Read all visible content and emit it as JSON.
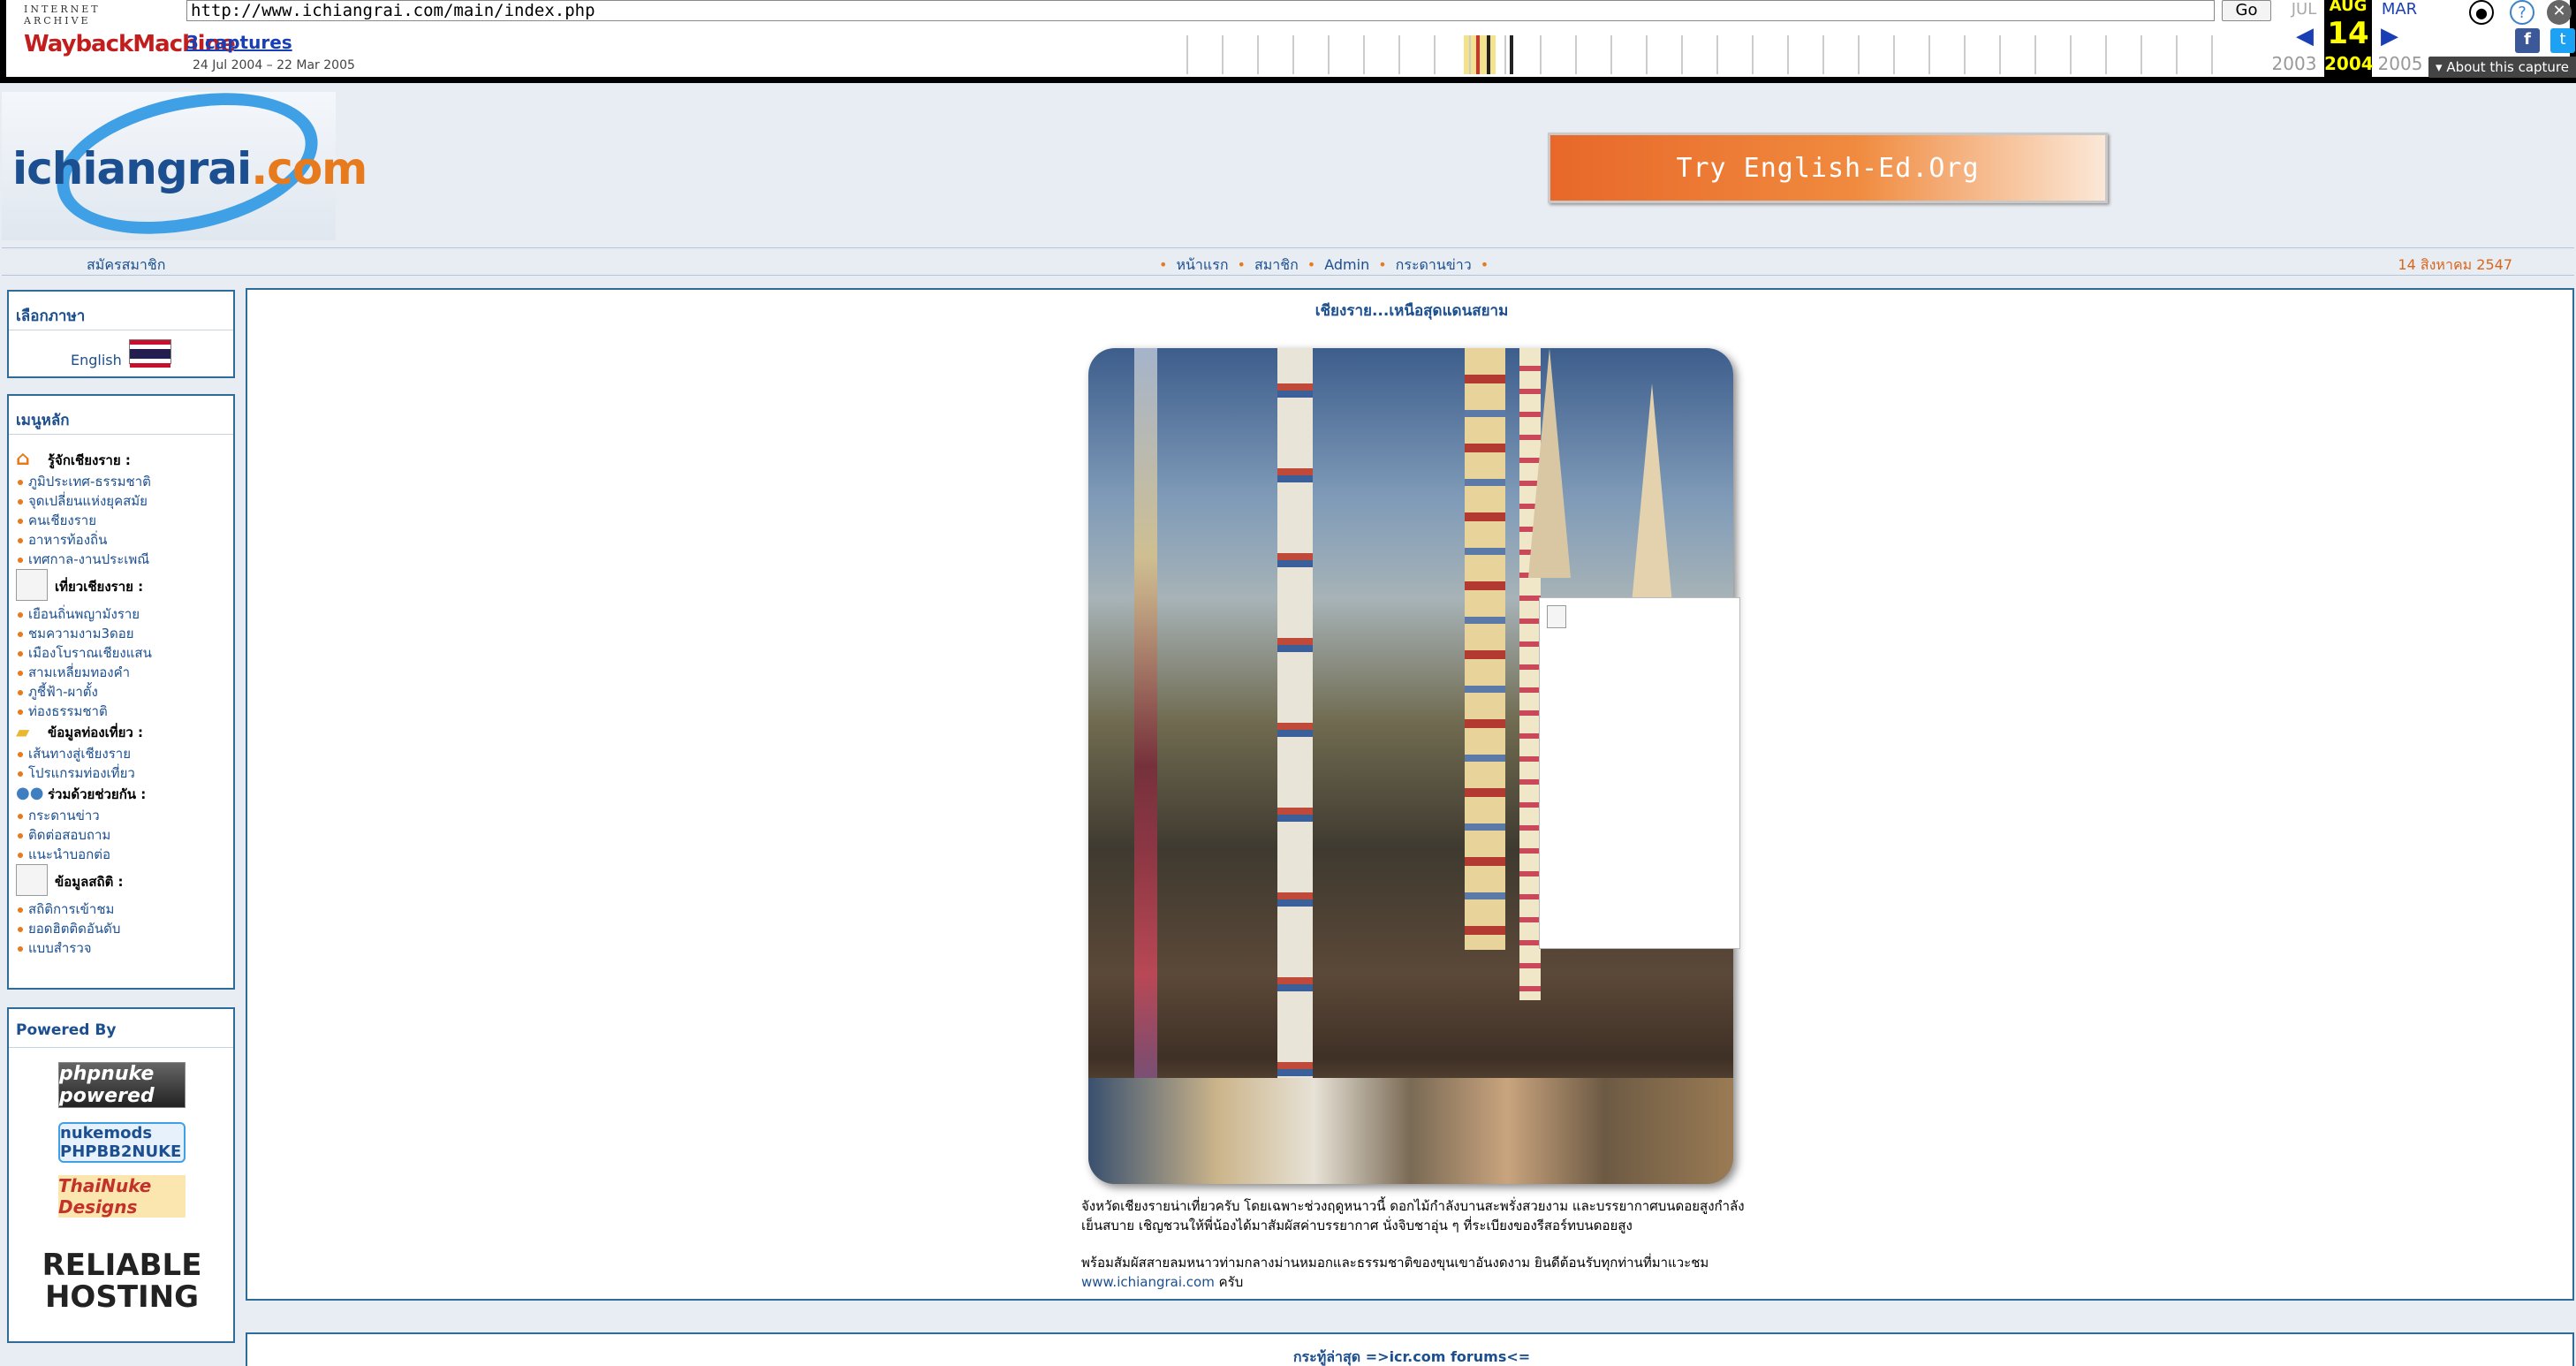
{
  "wayback": {
    "logo_top": "INTERNET ARCHIVE",
    "logo_main": "WaybackMachine",
    "url": "http://www.ichiangrai.com/main/index.php",
    "go_label": "Go",
    "captures": "3 captures",
    "range": "24 Jul 2004 – 22 Mar 2005",
    "month_prev": "JUL",
    "month_cur": "AUG",
    "month_next": "MAR",
    "day": "14",
    "year_prev": "2003",
    "year_cur": "2004",
    "year_next": "2005",
    "about": "About this capture",
    "icons": [
      "user-icon",
      "help-icon",
      "close-icon",
      "facebook-icon",
      "twitter-icon"
    ]
  },
  "site": {
    "logo_part1": "ichiangrai",
    "logo_part2": ".com",
    "banner_text": "Try English-Ed.Org",
    "nav": {
      "register": "สมัครสมาชิก",
      "links": [
        "หน้าแรก",
        "สมาชิก",
        "Admin",
        "กระดานข่าว"
      ],
      "date": "14 สิงหาคม 2547"
    }
  },
  "sidebar": {
    "language": {
      "title": "เลือกภาษา",
      "option": "English"
    },
    "menu": {
      "title": "เมนูหลัก",
      "sections": [
        {
          "title": "รู้จักเชียงราย :",
          "items": [
            "ภูมิประเทศ-ธรรมชาติ",
            "จุดเปลี่ยนแห่งยุคสมัย",
            "คนเชียงราย",
            "อาหารท้องถิ่น",
            "เทศกาล-งานประเพณี"
          ]
        },
        {
          "title": "เที่ยวเชียงราย :",
          "items": [
            "เยือนถิ่นพญามังราย",
            "ชมความงาม3ดอย",
            "เมืองโบราณเชียงแสน",
            "สามเหลี่ยมทองคำ",
            "ภูชี้ฟ้า-ผาตั้ง",
            "ท่องธรรมชาติ"
          ]
        },
        {
          "title": "ข้อมูลท่องเที่ยว :",
          "items": [
            "เส้นทางสู่เชียงราย",
            "โปรแกรมท่องเที่ยว"
          ]
        },
        {
          "title": "ร่วมด้วยช่วยกัน :",
          "items": [
            "กระดานข่าว",
            "ติดต่อสอบถาม",
            "แนะนำบอกต่อ"
          ]
        },
        {
          "title": "ข้อมูลสถิติ :",
          "items": [
            "สถิติการเข้าชม",
            "ยอดฮิตติดอันดับ",
            "แบบสำรวจ"
          ]
        }
      ]
    },
    "powered": {
      "title": "Powered By",
      "badges": [
        "phpnuke powered",
        "nukemods PHPBB2NUKE",
        "ThaiNuke Designs",
        "RELIABLE HOSTING"
      ]
    }
  },
  "main": {
    "title": "เชียงราย...เหนือสุดแดนสยาม",
    "para1": "จังหวัดเชียงรายน่าเที่ยวครับ โดยเฉพาะช่วงฤดูหนาวนี้ ดอกไม้กำลังบานสะพรั่งสวยงาม และบรรยากาศบนดอยสูงกำลังเย็นสบาย เชิญชวนให้พี่น้องได้มาสัมผัสค่าบรรยากาศ นั่งจิบชาอุ่น ๆ ที่ระเบียงของรีสอร์ทบนดอยสูง",
    "para2": "พร้อมสัมผัสสายลมหนาวท่ามกลางม่านหมอกและธรรมชาติของขุนเขาอันงดงาม ยินดีต้อนรับทุกท่านที่มาแวะชม",
    "para2_link": "www.ichiangrai.com",
    "para2_end": " ครับ"
  },
  "footer": {
    "link": "กระทู้ล่าสุด =>icr.com forums<="
  }
}
